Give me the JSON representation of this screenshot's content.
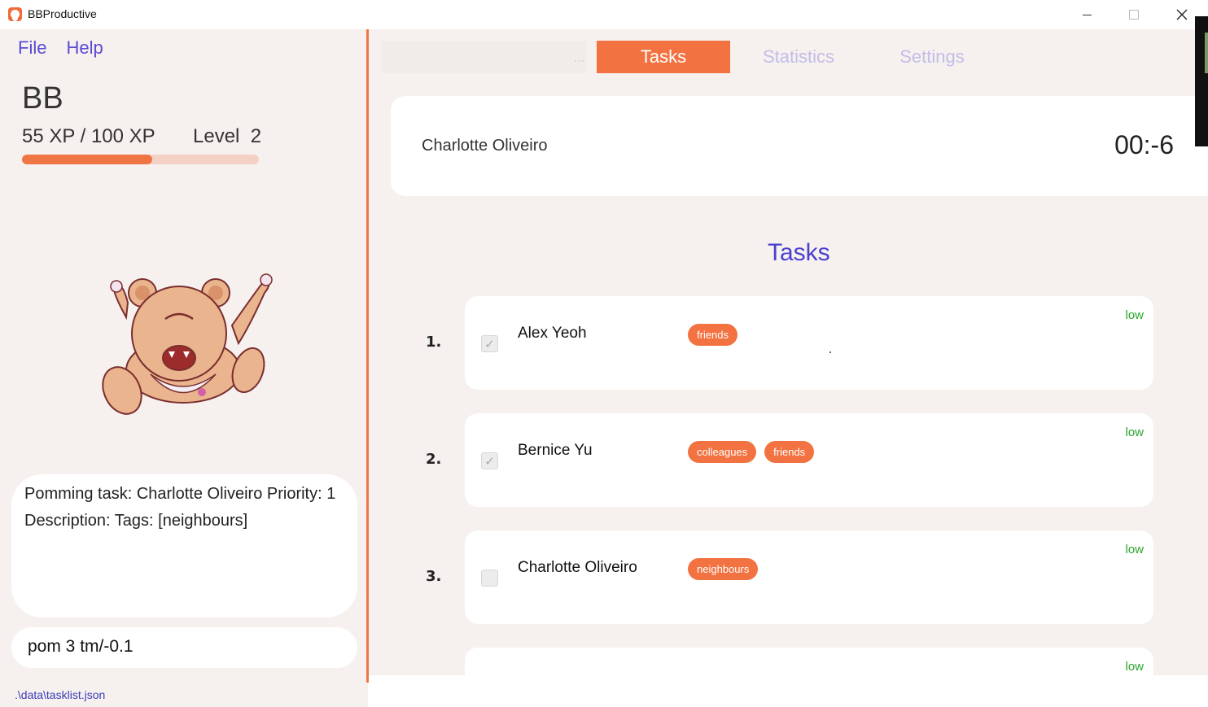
{
  "window": {
    "title": "BBProductive"
  },
  "menu": {
    "file": "File",
    "help": "Help"
  },
  "user": {
    "name": "BB",
    "xp_text": "55 XP / 100 XP",
    "level_text": "Level  2",
    "xp_fraction": 0.55
  },
  "result": {
    "text": "Pomming task: Charlotte Oliveiro Priority: 1 Description:  Tags: [neighbours]"
  },
  "command": {
    "value": "pom 3 tm/-0.1"
  },
  "status": {
    "path": ".\\data\\tasklist.json"
  },
  "tabs": {
    "placeholder_dots": "...",
    "tasks": "Tasks",
    "statistics": "Statistics",
    "settings": "Settings"
  },
  "timer": {
    "task": "Charlotte Oliveiro",
    "value": "00:-6"
  },
  "tasks": {
    "heading": "Tasks",
    "items": [
      {
        "index": "1.",
        "name": "Alex Yeoh",
        "tags": [
          "friends"
        ],
        "priority": "low",
        "done": true
      },
      {
        "index": "2.",
        "name": "Bernice Yu",
        "tags": [
          "colleagues",
          "friends"
        ],
        "priority": "low",
        "done": true
      },
      {
        "index": "3.",
        "name": "Charlotte Oliveiro",
        "tags": [
          "neighbours"
        ],
        "priority": "low",
        "done": false
      },
      {
        "index": "",
        "name": "",
        "tags": [],
        "priority": "low",
        "done": false
      }
    ]
  },
  "colors": {
    "accent": "#f37241",
    "link": "#5b4ad4",
    "priority_low": "#2aa52a"
  },
  "icons": {
    "close": "close-icon",
    "minimize": "minimize-icon",
    "maximize": "maximize-icon",
    "app": "app-logo-icon",
    "checkmark": "checkmark-icon"
  }
}
